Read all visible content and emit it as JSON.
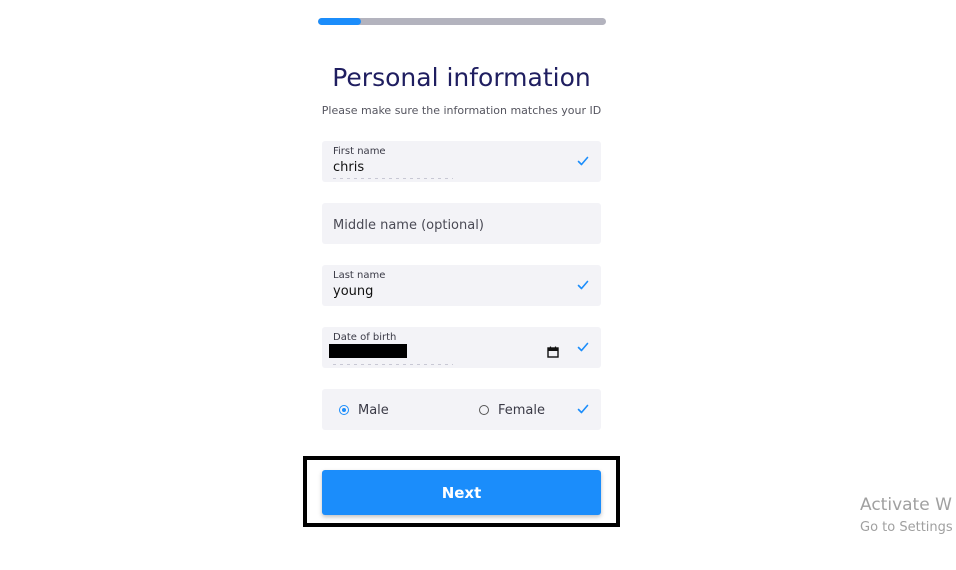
{
  "progress": {
    "percent": 15
  },
  "header": {
    "title": "Personal information",
    "subtitle": "Please make sure the information matches your ID"
  },
  "form": {
    "first_name": {
      "label": "First name",
      "value": "chris"
    },
    "middle_name": {
      "placeholder": "Middle name (optional)"
    },
    "last_name": {
      "label": "Last name",
      "value": "young"
    },
    "date_of_birth": {
      "label": "Date of birth"
    },
    "gender": {
      "options": [
        "Male",
        "Female"
      ],
      "selected": "Male"
    }
  },
  "actions": {
    "next_label": "Next"
  },
  "watermark": {
    "line1": "Activate W",
    "line2": "Go to Settings"
  },
  "colors": {
    "accent": "#1b8dfb",
    "title": "#1f1e60",
    "field_bg": "#f3f3f7"
  },
  "icons": [
    "check-icon",
    "calendar-icon"
  ]
}
